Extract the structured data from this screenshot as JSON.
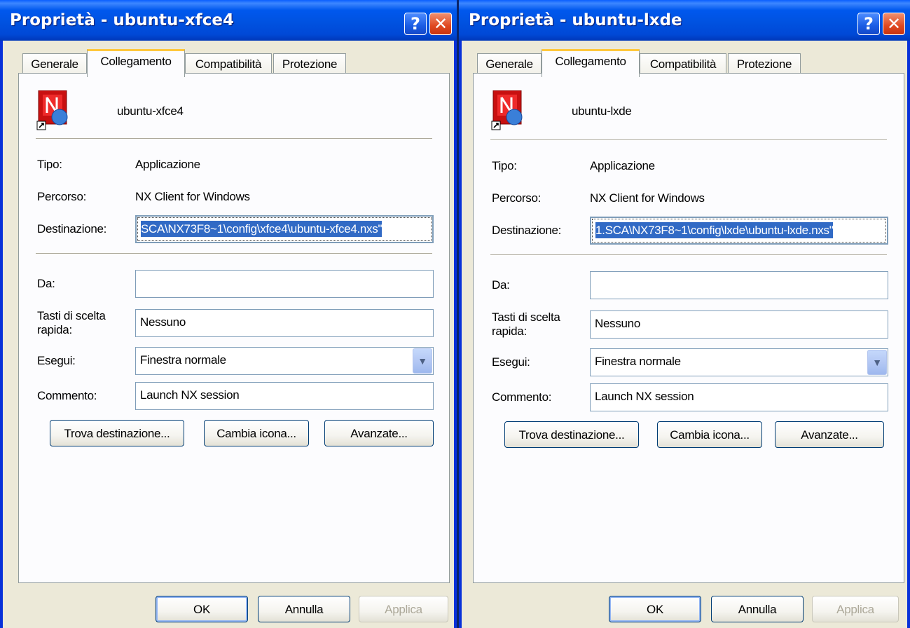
{
  "left": {
    "title": "Proprietà - ubuntu-xfce4",
    "help": "?",
    "close": "✕",
    "tabs": [
      "Generale",
      "Collegamento",
      "Compatibilità",
      "Protezione"
    ],
    "shortcut_name": "ubuntu-xfce4",
    "labels": {
      "tipo": "Tipo:",
      "percorso": "Percorso:",
      "destinazione": "Destinazione:",
      "da": "Da:",
      "tasti_1": "Tasti di scelta",
      "tasti_2": "rapida:",
      "esegui": "Esegui:",
      "commento": "Commento:"
    },
    "values": {
      "tipo": "Applicazione",
      "percorso": "NX Client for Windows",
      "destinazione": "SCA\\NX73F8~1\\config\\xfce4\\ubuntu-xfce4.nxs\"",
      "da": "",
      "tasti": "Nessuno",
      "esegui": "Finestra normale",
      "commento": "Launch NX session"
    },
    "buttons": {
      "trova": "Trova destinazione...",
      "cambia": "Cambia icona...",
      "avanzate": "Avanzate...",
      "ok": "OK",
      "annulla": "Annulla",
      "applica": "Applica"
    }
  },
  "right": {
    "title": "Proprietà - ubuntu-lxde",
    "help": "?",
    "close": "✕",
    "tabs": [
      "Generale",
      "Collegamento",
      "Compatibilità",
      "Protezione"
    ],
    "shortcut_name": "ubuntu-lxde",
    "labels": {
      "tipo": "Tipo:",
      "percorso": "Percorso:",
      "destinazione": "Destinazione:",
      "da": "Da:",
      "tasti_1": "Tasti di scelta",
      "tasti_2": "rapida:",
      "esegui": "Esegui:",
      "commento": "Commento:"
    },
    "values": {
      "tipo": "Applicazione",
      "percorso": "NX Client for Windows",
      "destinazione": "1.SCA\\NX73F8~1\\config\\lxde\\ubuntu-lxde.nxs\"",
      "da": "",
      "tasti": "Nessuno",
      "esegui": "Finestra normale",
      "commento": "Launch NX session"
    },
    "buttons": {
      "trova": "Trova destinazione...",
      "cambia": "Cambia icona...",
      "avanzate": "Avanzate...",
      "ok": "OK",
      "annulla": "Annulla",
      "applica": "Applica"
    }
  },
  "colors": {
    "titlebar": "#0054e3",
    "dialog_bg": "#ece9d8",
    "selection": "#316ac5",
    "tab_highlight": "#ffc83c"
  },
  "icons": [
    "nx-shortcut-icon",
    "help-icon",
    "close-icon",
    "chevron-down-icon"
  ]
}
